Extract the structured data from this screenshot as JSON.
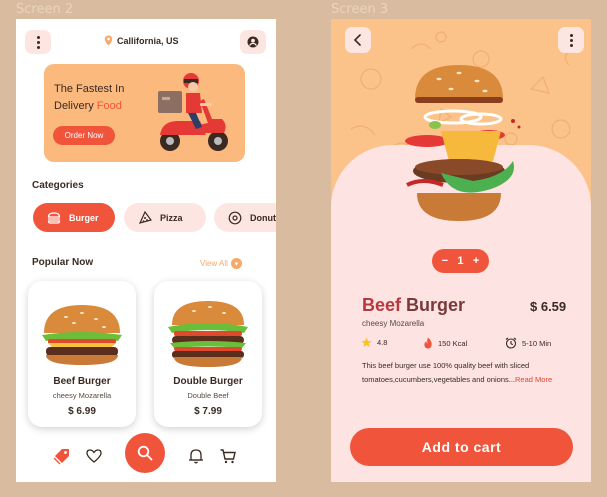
{
  "screens": {
    "left_title": "Screen 2",
    "right_title": "Screen 3"
  },
  "home": {
    "location": "Callifornia, US",
    "banner": {
      "line1": "The Fastest In",
      "line2_prefix": "Delivery",
      "line2_highlight": "Food",
      "cta": "Order Now"
    },
    "categories_title": "Categories",
    "categories": [
      {
        "label": "Burger",
        "icon": "burger-icon",
        "active": true
      },
      {
        "label": "Pizza",
        "icon": "pizza-icon",
        "active": false
      },
      {
        "label": "Donut",
        "icon": "donut-icon",
        "active": false
      }
    ],
    "popular_title": "Popular Now",
    "view_all": "View All",
    "products": [
      {
        "name": "Beef Burger",
        "subtitle": "cheesy Mozarella",
        "price": "$ 6.99"
      },
      {
        "name": "Double Burger",
        "subtitle": "Double Beef",
        "price": "$ 7.99"
      }
    ],
    "nav": [
      "tag-icon",
      "heart-icon",
      "search-icon",
      "bell-icon",
      "cart-icon"
    ]
  },
  "detail": {
    "quantity": {
      "minus": "−",
      "value": "1",
      "plus": "+"
    },
    "name_word1": "Beef",
    "name_word2": "Burger",
    "price": "$ 6.59",
    "subtitle": "cheesy Mozarella",
    "stats": {
      "rating": "4.8",
      "calories": "150 Kcal",
      "time": "5-10 Min"
    },
    "description": "This beef burger use 100% quality beef with sliced tomatoes,cucumbers,vegetables and onions...",
    "read_more": "Read More",
    "add_to_cart": "Add to cart"
  },
  "colors": {
    "accent": "#f0553c",
    "banner": "#fcb97d",
    "pink": "#fde6e1",
    "background": "#d9bc9f"
  }
}
